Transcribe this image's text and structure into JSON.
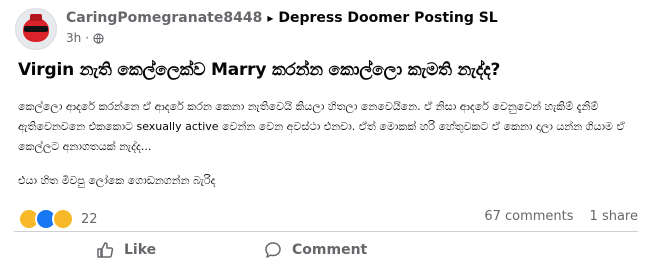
{
  "post": {
    "author": "CaringPomegranate8448",
    "separator": "▸",
    "group": "Depress Doomer Posting SL",
    "time": "3h",
    "dot": "·",
    "title": "Virgin නැති කෙල්ලෙක්ව Marry කරන්න කොල්ලො කැමති නැද්ද?",
    "body_paragraph_1": "කෙල්ලො ආදරේ කරන්නෙ ඒ ආදරේ කරන කෙනා නැතිවෙයි කියලා හිතලා නෙවෙයිනෙ. ඒ නිසා ආදරේ වෙනුවෙන් හැකිම් දැනිම් ඇතිවෙනවනෙ එකකොට sexually active වෙන්න වෙන අවස්ථා එනවා. ඒත් මොකක් හරි හේතුවකට ඒ කෙනා දාලා යන්න ගියාම ඒ කෙල්ලට අනාගතයක් නැද්ද...",
    "body_paragraph_2": "එයා හිත මිවපු ලෝකෙ ගොඩනගන්න බැරිද"
  },
  "reactions": {
    "icons": [
      "haha-icon",
      "like-icon",
      "sad-icon"
    ],
    "count": "22"
  },
  "stats": {
    "comments": "67 comments",
    "shares": "1 share"
  },
  "actions": {
    "like_label": "Like",
    "comment_label": "Comment"
  },
  "colors": {
    "secondary_text": "#65676b",
    "primary_text": "#050505",
    "like_blue": "#1877f2",
    "reaction_yellow": "#f7b928"
  }
}
